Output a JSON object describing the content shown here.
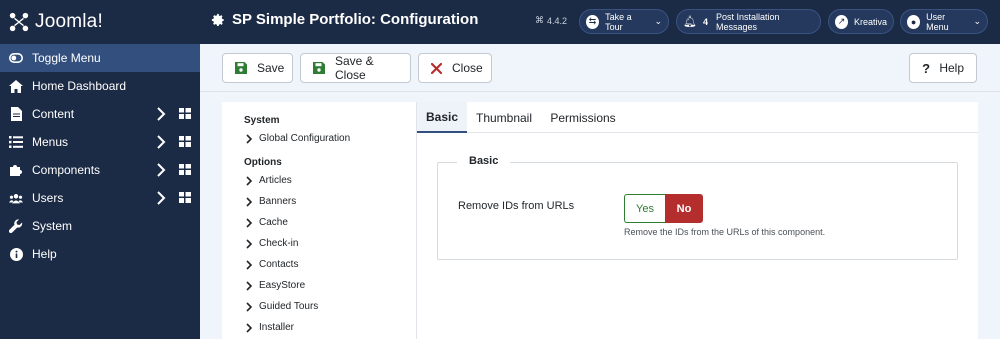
{
  "app": {
    "logo_text": "Joomla!",
    "version": "4.4.2"
  },
  "header": {
    "page_title": "SP Simple Portfolio: Configuration",
    "take_tour_label": "Take a Tour",
    "notification_count": "4",
    "post_install_label": "Post Installation Messages",
    "site_label": "Kreativa",
    "user_menu_label": "User Menu"
  },
  "sidebar": {
    "items": [
      {
        "label": "Toggle Menu",
        "icon": "toggle-icon",
        "active": true
      },
      {
        "label": "Home Dashboard",
        "icon": "home-icon"
      },
      {
        "label": "Content",
        "icon": "file-icon",
        "expandable": true
      },
      {
        "label": "Menus",
        "icon": "list-icon",
        "expandable": true
      },
      {
        "label": "Components",
        "icon": "puzzle-icon",
        "expandable": true
      },
      {
        "label": "Users",
        "icon": "users-icon",
        "expandable": true
      },
      {
        "label": "System",
        "icon": "wrench-icon"
      },
      {
        "label": "Help",
        "icon": "info-icon"
      }
    ]
  },
  "toolbar": {
    "save_label": "Save",
    "save_close_label": "Save & Close",
    "close_label": "Close",
    "help_label": "Help"
  },
  "leftnav": {
    "system_heading": "System",
    "global_config": "Global Configuration",
    "options_heading": "Options",
    "options": [
      "Articles",
      "Banners",
      "Cache",
      "Check-in",
      "Contacts",
      "EasyStore",
      "Guided Tours",
      "Installer"
    ]
  },
  "tabs": [
    "Basic",
    "Thumbnail",
    "Permissions"
  ],
  "form": {
    "legend": "Basic",
    "field_label": "Remove IDs from URLs",
    "yes_label": "Yes",
    "no_label": "No",
    "selected": "No",
    "description": "Remove the IDs from the URLs of this component."
  },
  "colors": {
    "header_bg": "#1c2b45",
    "sidebar_active": "#324f7e",
    "yes_green": "#2f7d32",
    "no_red": "#b52e2e",
    "save_icon_green": "#2f7d32",
    "close_icon_red": "#b52e2e"
  }
}
